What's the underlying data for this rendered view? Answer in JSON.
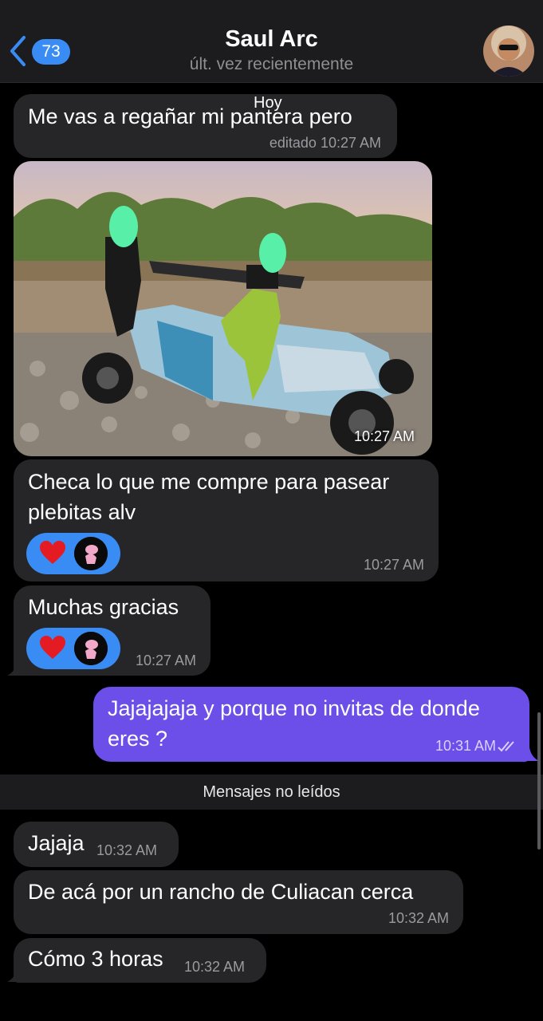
{
  "header": {
    "unread_count": "73",
    "title": "Saul Arc",
    "status": "últ. vez recientemente"
  },
  "date_separator": "Hoy",
  "messages": [
    {
      "text": "Me vas a regañar mi pantera pero",
      "time": "editado 10:27 AM"
    },
    {
      "photo_time": "10:27 AM"
    },
    {
      "text_line1": "Checa lo que me compre para pasear",
      "text_line2": "plebitas alv",
      "time": "10:27 AM"
    },
    {
      "text": "Muchas gracias",
      "time": "10:27 AM"
    },
    {
      "text_line1": "Jajajajaja y porque no invitas de donde",
      "text_line2": "eres ?",
      "time": "10:31 AM"
    },
    {
      "text": "Jajaja",
      "time": "10:32 AM"
    },
    {
      "text": "De acá por un rancho de Culiacan cerca",
      "time": "10:32 AM"
    },
    {
      "text": "Cómo 3 horas",
      "time": "10:32 AM"
    }
  ],
  "unread_divider": "Mensajes no leídos",
  "colors": {
    "incoming_bubble": "#262628",
    "outgoing_bubble": "#6c4ee8",
    "accent": "#3a8cf5",
    "background": "#000000"
  },
  "icons": [
    "back-chevron-icon",
    "heart-icon",
    "double-check-icon"
  ]
}
